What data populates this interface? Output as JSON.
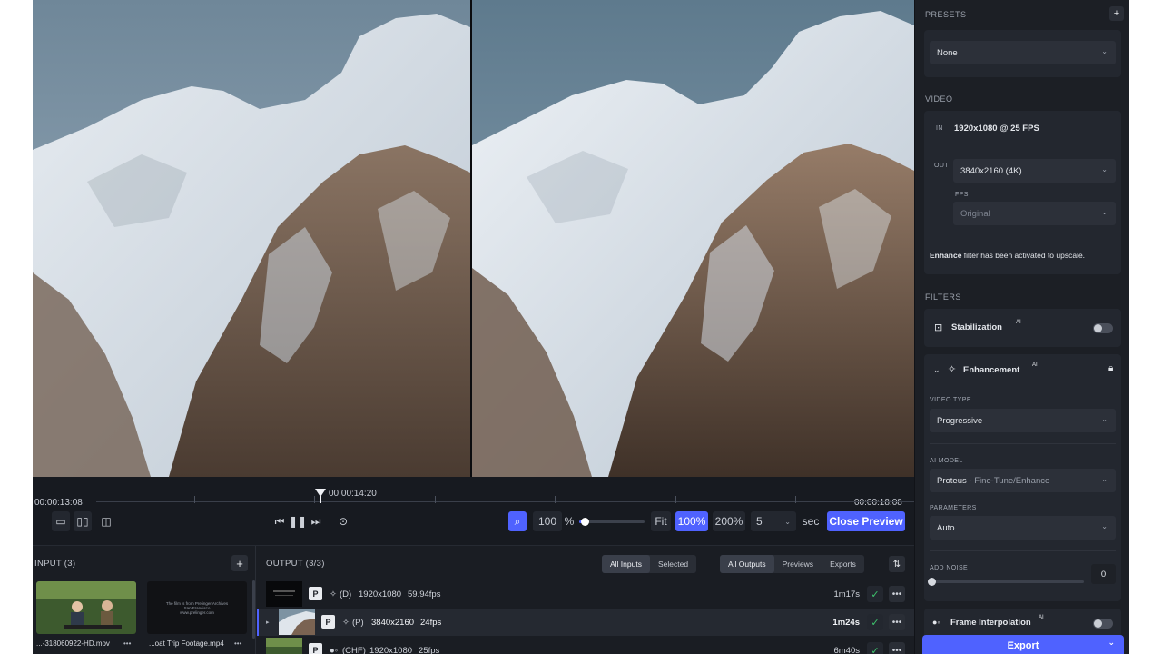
{
  "timeline": {
    "start_time": "00:00:13:08",
    "current_time": "00:00:14:20",
    "end_time": "00:00:18:08"
  },
  "controls": {
    "zoom_value": "100",
    "zoom_unit": "%",
    "zoom_slider_level": 0.05,
    "fit_label": "Fit",
    "zoom_100_label": "100%",
    "zoom_200_label": "200%",
    "duration_value": "5",
    "duration_unit": "sec",
    "close_preview_label": "Close Preview"
  },
  "input_panel": {
    "title": "INPUT (3)",
    "add_label": "+",
    "files": [
      {
        "name": "...-318060922-HD.mov",
        "more": "•••"
      },
      {
        "name": "...oat Trip Footage.mp4",
        "more": "•••",
        "thumb_lines": [
          "The film is from Prelinger Archives",
          "San Francisco",
          "www.prelinger.com"
        ]
      }
    ]
  },
  "output_panel": {
    "title": "OUTPUT (3/3)",
    "filter_group_1": [
      "All Inputs",
      "Selected"
    ],
    "filter_group_2": [
      "All Outputs",
      "Previews",
      "Exports"
    ],
    "sort_icon": "⇅",
    "rows": [
      {
        "badge": "P",
        "model": "(D)",
        "resolution": "1920x1080",
        "fps": "59.94fps",
        "duration": "1m17s",
        "check": "✓",
        "more": "•••"
      },
      {
        "badge": "P",
        "model": "(P)",
        "resolution": "3840x2160",
        "fps": "24fps",
        "duration": "1m24s",
        "check": "✓",
        "more": "•••"
      },
      {
        "badge": "P",
        "model": "(CHF)",
        "resolution": "1920x1080",
        "fps": "25fps",
        "duration": "6m40s",
        "check": "✓",
        "more": "•••"
      }
    ]
  },
  "sidebar": {
    "presets_title": "PRESETS",
    "presets_add": "+",
    "preset_value": "None",
    "video_title": "VIDEO",
    "in_label": "IN",
    "in_value": "1920x1080 @ 25 FPS",
    "out_label": "OUT",
    "out_value": "3840x2160 (4K)",
    "fps_label": "FPS",
    "fps_value": "Original",
    "enhance_note_strong": "Enhance",
    "enhance_note_rest": " filter has been activated to upscale.",
    "filters_title": "FILTERS",
    "stabilization_label": "Stabilization",
    "stabilization_badge": "AI",
    "enhancement_label": "Enhancement",
    "enhancement_badge": "AI",
    "video_type_label": "VIDEO TYPE",
    "video_type_value": "Progressive",
    "ai_model_label": "AI MODEL",
    "ai_model_value": "Proteus",
    "ai_model_sub": " - Fine-Tune/Enhance",
    "parameters_label": "PARAMETERS",
    "parameters_value": "Auto",
    "add_noise_label": "ADD NOISE",
    "add_noise_value": "0",
    "frame_interp_label": "Frame Interpolation",
    "frame_interp_badge": "AI",
    "export_label": "Export"
  },
  "colors": {
    "accent": "#4f62ff",
    "panel_bg": "#1c1f25",
    "check_green": "#3ec46d"
  }
}
